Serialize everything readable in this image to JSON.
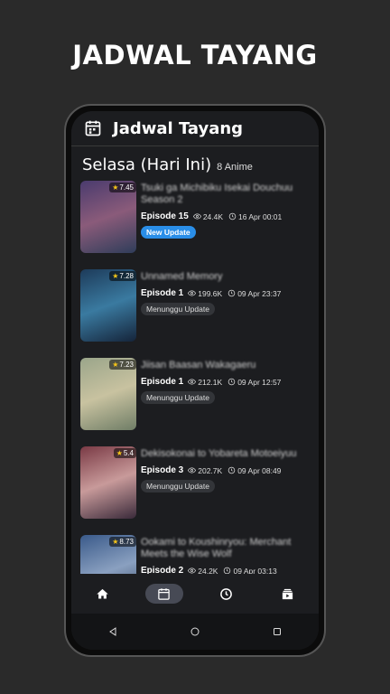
{
  "promo": {
    "title": "JADWAL TAYANG"
  },
  "appbar": {
    "title": "Jadwal Tayang",
    "icon": "calendar-icon"
  },
  "section": {
    "day": "Selasa (Hari Ini)",
    "count": "8 Anime"
  },
  "anime": [
    {
      "title": "Tsuki ga Michibiku Isekai Douchuu Season 2",
      "rating": "7.45",
      "episode": "Episode 15",
      "views": "24.4K",
      "time": "16 Apr 00:01",
      "status": "New Update",
      "status_type": "new",
      "thumb_colors": [
        "#4a3b6e",
        "#8a5b7a",
        "#2f3d5a"
      ]
    },
    {
      "title": "Unnamed Memory",
      "rating": "7.28",
      "episode": "Episode 1",
      "views": "199.6K",
      "time": "09 Apr 23:37",
      "status": "Menunggu Update",
      "status_type": "wait",
      "thumb_colors": [
        "#1d3b5a",
        "#3a7aa0",
        "#15243a"
      ]
    },
    {
      "title": "Jiisan Baasan Wakagaeru",
      "rating": "7.23",
      "episode": "Episode 1",
      "views": "212.1K",
      "time": "09 Apr 12:57",
      "status": "Menunggu Update",
      "status_type": "wait",
      "thumb_colors": [
        "#9aa58a",
        "#c8c2a0",
        "#6f7d66"
      ]
    },
    {
      "title": "Dekisokonai to Yobareta Motoeiyuu",
      "rating": "5.4",
      "episode": "Episode 3",
      "views": "202.7K",
      "time": "09 Apr 08:49",
      "status": "Menunggu Update",
      "status_type": "wait",
      "thumb_colors": [
        "#7a3a45",
        "#c89a9a",
        "#3a2a3a"
      ]
    },
    {
      "title": "Ookami to Koushinryou: Merchant Meets the Wise Wolf",
      "rating": "8.73",
      "episode": "Episode 2",
      "views": "24.2K",
      "time": "09 Apr 03:13",
      "status": "",
      "status_type": "none",
      "thumb_colors": [
        "#3a5a8a",
        "#8aa0c0",
        "#2a3a55"
      ]
    }
  ],
  "bottom_nav": [
    {
      "name": "home-icon",
      "active": false
    },
    {
      "name": "calendar-icon",
      "active": true
    },
    {
      "name": "clock-icon",
      "active": false
    },
    {
      "name": "library-icon",
      "active": false
    }
  ],
  "colors": {
    "accent": "#2a8ee8",
    "background": "#1c1d20",
    "star": "#f5c518"
  }
}
